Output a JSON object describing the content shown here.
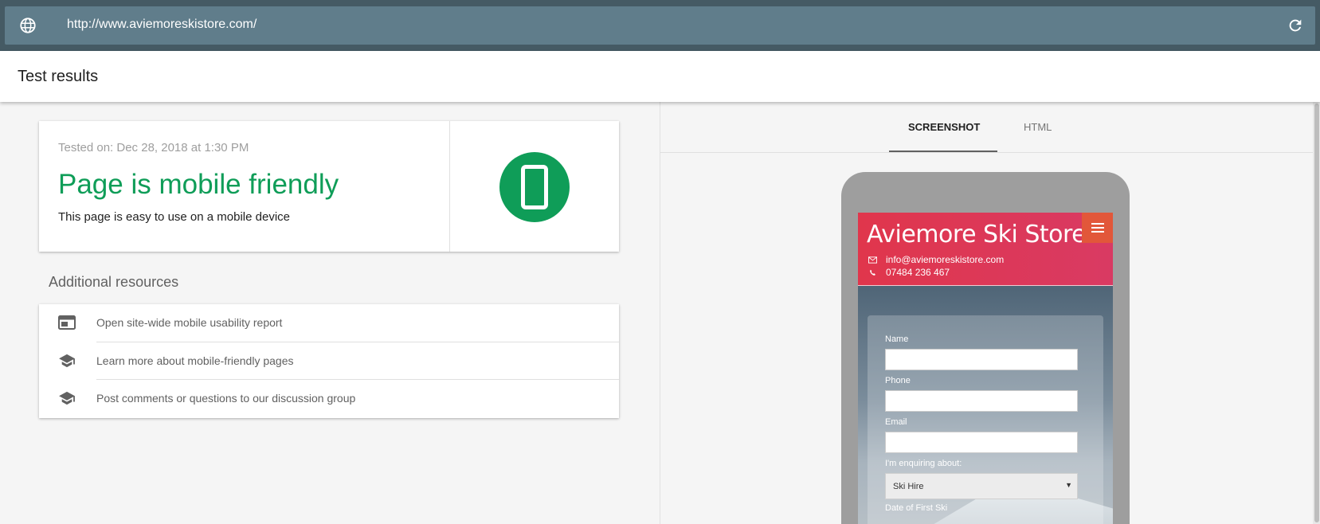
{
  "url_bar": {
    "url": "http://www.aviemoreskistore.com/",
    "globe_icon": "globe-icon",
    "reload_icon": "reload-icon"
  },
  "header": {
    "title": "Test results"
  },
  "result": {
    "tested_on": "Tested on: Dec 28, 2018 at 1:30 PM",
    "verdict": "Page is mobile friendly",
    "description": "This page is easy to use on a mobile device",
    "verdict_color": "#0f9d58",
    "badge_icon": "smartphone-icon"
  },
  "resources": {
    "title": "Additional resources",
    "items": [
      {
        "label": "Open site-wide mobile usability report",
        "icon": "web-report-icon"
      },
      {
        "label": "Learn more about mobile-friendly pages",
        "icon": "school-icon"
      },
      {
        "label": "Post comments or questions to our discussion group",
        "icon": "school-icon"
      }
    ]
  },
  "tabs": {
    "screenshot": "SCREENSHOT",
    "html": "HTML",
    "active": "SCREENSHOT"
  },
  "preview": {
    "site_title": "Aviemore Ski Store",
    "email": "info@aviemoreskistore.com",
    "phone": "07484 236 467",
    "menu_icon": "hamburger-menu-icon",
    "form": {
      "name_label": "Name",
      "phone_label": "Phone",
      "email_label": "Email",
      "enquiry_label": "I'm enquiring about:",
      "enquiry_value": "Ski Hire",
      "date_label": "Date of First Ski"
    },
    "colors": {
      "header_start": "#e0364c",
      "header_end": "#d93a63",
      "menu_button": "#e2573a"
    }
  }
}
